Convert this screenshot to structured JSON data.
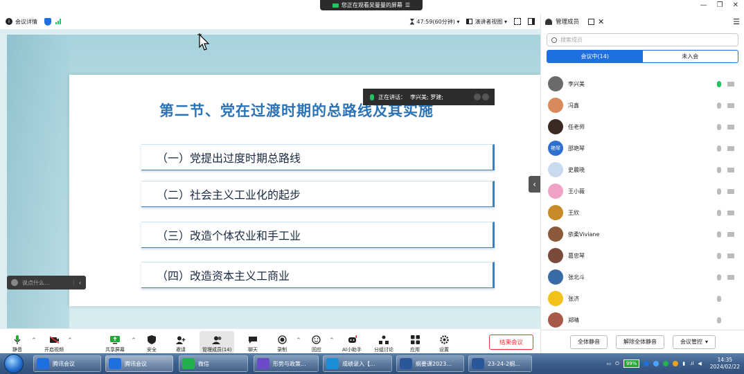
{
  "banner": {
    "text": "您正在观看吴曼曼的屏幕"
  },
  "topbar": {
    "meeting_details": "会议详情",
    "timer": "47:59(60分钟)",
    "view_mode": "演讲者视图"
  },
  "slide": {
    "title": "第二节、党在过渡时期的总路线及其实施",
    "items": [
      "（一）党提出过度时期总路线",
      "（二）社会主义工业化的起步",
      "（三）改造个体农业和手工业",
      "（四）改造资本主义工商业"
    ]
  },
  "speaking": {
    "label": "正在讲话：",
    "names": "李兴美; 罗建;"
  },
  "chat": {
    "placeholder": "说点什么..."
  },
  "panel": {
    "title": "管理成员",
    "search_placeholder": "搜索成员",
    "tab_in_meeting": "会议中(14)",
    "tab_not_joined": "未入会",
    "members": [
      {
        "name": "李兴美",
        "mic_on": true,
        "avatar_color": "#6b6b6b",
        "avatar_text": ""
      },
      {
        "name": "冯鑫",
        "mic_on": false,
        "avatar_color": "#d98a5a",
        "avatar_text": ""
      },
      {
        "name": "任老师",
        "mic_on": false,
        "avatar_color": "#3a2a22",
        "avatar_text": ""
      },
      {
        "name": "邵艳琴",
        "mic_on": false,
        "avatar_color": "#2f6fd0",
        "avatar_text": "艳琴"
      },
      {
        "name": "史晨晓",
        "mic_on": false,
        "avatar_color": "#c9d9ee",
        "avatar_text": ""
      },
      {
        "name": "王小薇",
        "mic_on": false,
        "avatar_color": "#f0a3c6",
        "avatar_text": ""
      },
      {
        "name": "王欣",
        "mic_on": false,
        "avatar_color": "#c98a2a",
        "avatar_text": ""
      },
      {
        "name": "依柔Viviane",
        "mic_on": false,
        "avatar_color": "#8a5a3a",
        "avatar_text": ""
      },
      {
        "name": "葛忠琴",
        "mic_on": false,
        "avatar_color": "#7a4a3a",
        "avatar_text": ""
      },
      {
        "name": "张北斗",
        "mic_on": false,
        "avatar_color": "#3a6aa8",
        "avatar_text": ""
      },
      {
        "name": "张济",
        "mic_on": false,
        "avatar_color": "#f2c21a",
        "avatar_text": ""
      },
      {
        "name": "郑晴",
        "mic_on": false,
        "avatar_color": "#a85a4a",
        "avatar_text": ""
      }
    ],
    "mute_all": "全体静音",
    "unmute_all": "解除全体静音",
    "meeting_control": "会议管控"
  },
  "toolbar": {
    "mute": "静音",
    "video": "开启视频",
    "share": "共享屏幕",
    "security": "安全",
    "invite": "邀请",
    "members": "管理成员(14)",
    "chat": "聊天",
    "record": "录制",
    "react": "回应",
    "ai": "AI小助手",
    "breakout": "分组讨论",
    "apps": "应用",
    "settings": "设置",
    "end": "结束会议"
  },
  "taskbar": {
    "items": [
      {
        "label": "腾讯会议",
        "color": "#1e6fe0"
      },
      {
        "label": "腾讯会议",
        "color": "#1e6fe0"
      },
      {
        "label": "微信",
        "color": "#22b14c"
      },
      {
        "label": "形势与政策...",
        "color": "#6a4ac9"
      },
      {
        "label": "成绩录入【...",
        "color": "#1a8fd8"
      },
      {
        "label": "纲要课2023...",
        "color": "#2b579a"
      },
      {
        "label": "23-24-2纲...",
        "color": "#2b579a"
      }
    ],
    "battery": "99%",
    "time": "14:35",
    "date": "2024/02/22"
  }
}
